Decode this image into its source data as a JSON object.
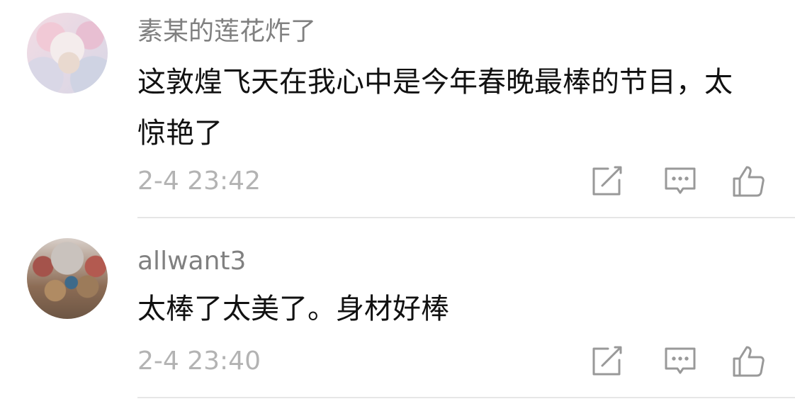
{
  "comments": [
    {
      "username": "素某的莲花炸了",
      "text": "这敦煌飞天在我心中是今年春晚最棒的节目，太惊艳了",
      "time": "2-4 23:42",
      "avatar_icon": "avatar-photo-icon",
      "actions": [
        "edit-icon",
        "reply-icon",
        "like-icon"
      ]
    },
    {
      "username": "allwant3",
      "text": "太棒了太美了。身材好棒",
      "time": "2-4 23:40",
      "avatar_icon": "avatar-photo-icon",
      "actions": [
        "edit-icon",
        "reply-icon",
        "like-icon"
      ]
    }
  ],
  "colors": {
    "username": "#808080",
    "text": "#111111",
    "time": "#b3b3b3",
    "icon": "#999999",
    "divider": "#e6e6e6"
  }
}
